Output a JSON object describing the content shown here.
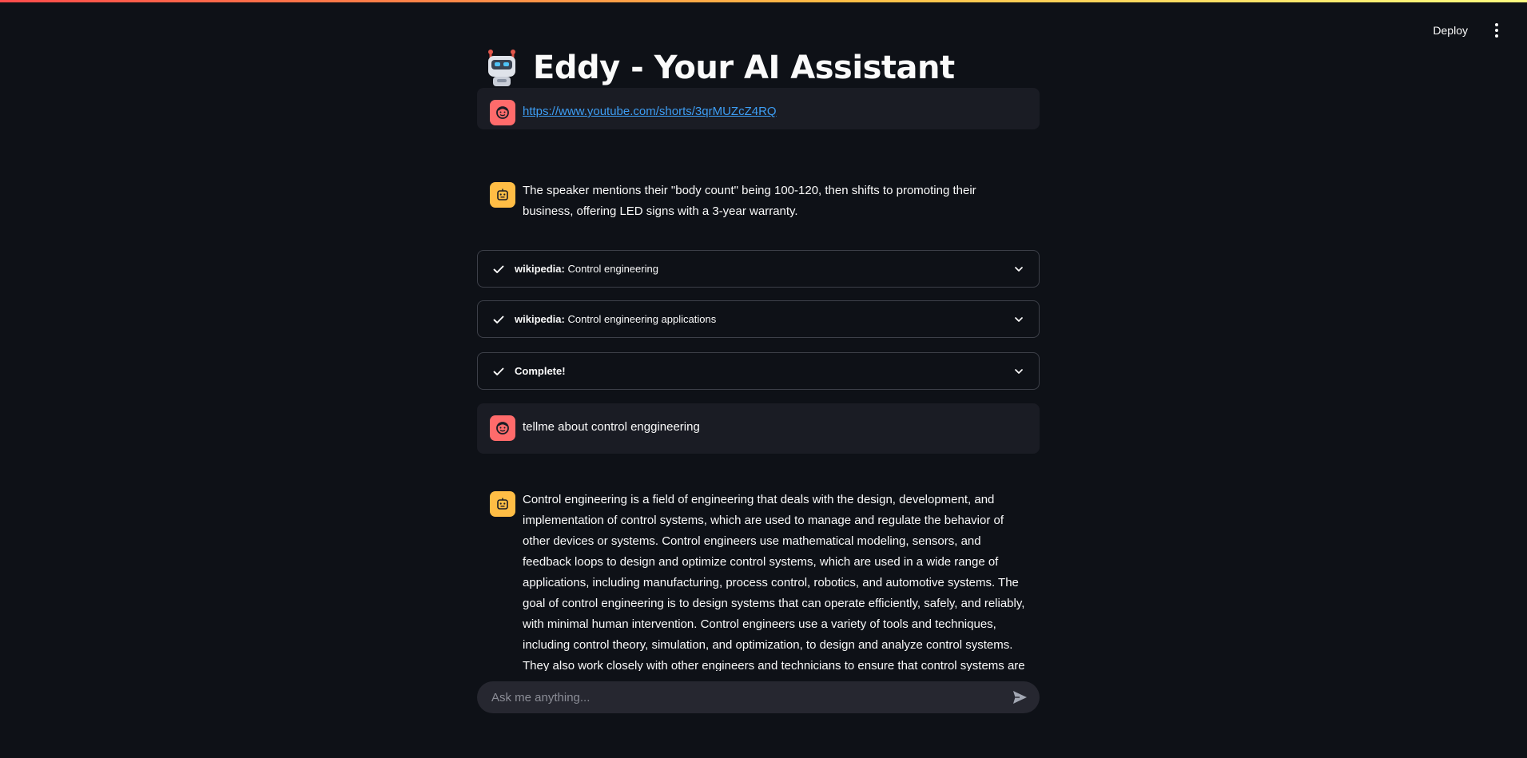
{
  "header": {
    "deploy_label": "Deploy",
    "menu_icon": "kebab-menu-icon"
  },
  "app": {
    "title": "Eddy - Your AI Assistant",
    "title_icon": "robot-emoji-icon"
  },
  "messages": [
    {
      "role": "user",
      "text": "https://www.youtube.com/shorts/3qrMUZcZ4RQ",
      "is_link": true
    },
    {
      "role": "assistant",
      "text": "The speaker mentions their \"body count\" being 100-120, then shifts to promoting their business, offering LED signs with a 3-year warranty."
    },
    {
      "role": "user",
      "text": "tellme about control enggineering"
    },
    {
      "role": "assistant",
      "text": "Control engineering is a field of engineering that deals with the design, development, and implementation of control systems, which are used to manage and regulate the behavior of other devices or systems. Control engineers use mathematical modeling, sensors, and feedback loops to design and optimize control systems, which are used in a wide range of applications, including manufacturing, process control, robotics, and automotive systems. The goal of control engineering is to design systems that can operate efficiently, safely, and reliably, with minimal human intervention. Control engineers use a variety of tools and techniques, including control theory, simulation, and optimization, to design and analyze control systems. They also work closely with other engineers and technicians to ensure that control systems are integrated with"
    }
  ],
  "expanders": [
    {
      "prefix": "wikipedia:",
      "text": "Control engineering"
    },
    {
      "prefix": "wikipedia:",
      "text": "Control engineering applications"
    },
    {
      "prefix": "Complete!",
      "text": ""
    }
  ],
  "chat_input": {
    "placeholder": "Ask me anything..."
  },
  "colors": {
    "background": "#0e1117",
    "user_bubble": "#1a1c24",
    "user_avatar": "#ff6b6b",
    "bot_avatar": "#ffbd45",
    "link": "#3d9df3"
  }
}
